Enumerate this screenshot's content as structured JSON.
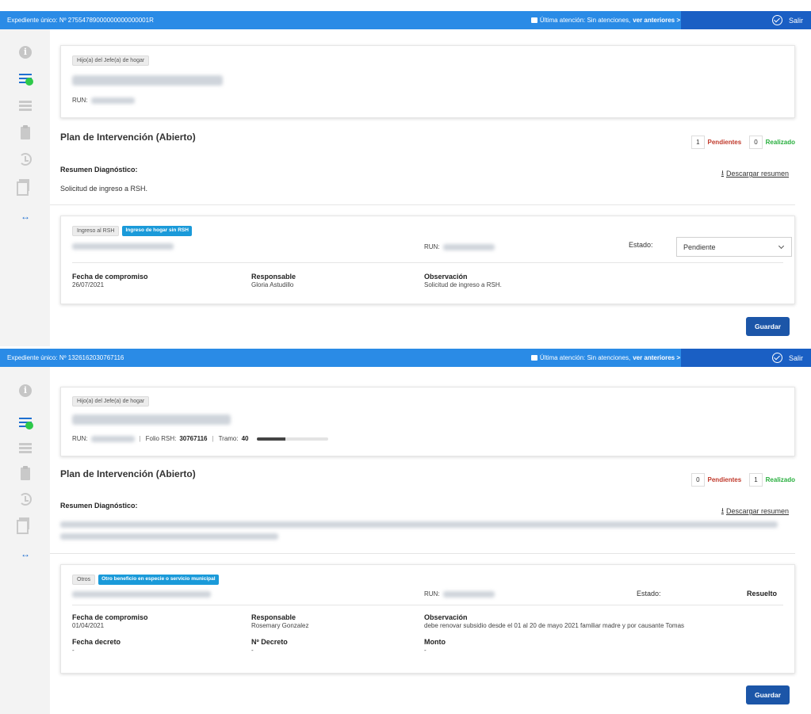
{
  "panels": [
    {
      "header": {
        "expediente": "Expediente único: Nº 27554789000000000000001R",
        "ultima_prefix": "Última atención: Sin atenciones,",
        "ultima_link": "ver anteriores >",
        "salir": "Salir"
      },
      "person": {
        "role_tag": "Hijo(a) del Jefe(a) de hogar",
        "run_label": "RUN:"
      },
      "plan": {
        "title": "Plan de Intervención (Abierto)",
        "pendientes_count": "1",
        "pendientes_label": "Pendientes",
        "realizado_count": "0",
        "realizado_label": "Realizado",
        "resumen_label": "Resumen Diagnóstico:",
        "download_label": "Descargar resumen",
        "diagnostico": "Solicitud de ingreso a RSH."
      },
      "commitment": {
        "tag": "Ingreso al RSH",
        "tag_highlight": "Ingreso de hogar sin RSH",
        "run_label": "RUN:",
        "estado_label": "Estado:",
        "estado_value": "Pendiente",
        "fecha_label": "Fecha de compromiso",
        "fecha_value": "26/07/2021",
        "responsable_label": "Responsable",
        "responsable_value": "Gloria Astudillo",
        "observacion_label": "Observación",
        "observacion_value": "Solicitud de ingreso a RSH."
      },
      "save_label": "Guardar"
    },
    {
      "header": {
        "expediente": "Expediente único: Nº 1326162030767116",
        "ultima_prefix": "Última atención: Sin atenciones,",
        "ultima_link": "ver anteriores >",
        "salir": "Salir"
      },
      "person": {
        "role_tag": "Hijo(a) del Jefe(a) de hogar",
        "run_label": "RUN:",
        "folio_label": "Folio RSH:",
        "folio_value": "30767116",
        "tramo_label": "Tramo:",
        "tramo_value": "40",
        "tramo_level": 0.4
      },
      "plan": {
        "title": "Plan de Intervención (Abierto)",
        "pendientes_count": "0",
        "pendientes_label": "Pendientes",
        "realizado_count": "1",
        "realizado_label": "Realizado",
        "resumen_label": "Resumen Diagnóstico:",
        "download_label": "Descargar resumen"
      },
      "commitment": {
        "tag": "Otros",
        "tag_highlight": "Otro beneficio en especie o servicio municipal",
        "run_label": "RUN:",
        "estado_label": "Estado:",
        "estado_value": "Resuelto",
        "fecha_label": "Fecha de compromiso",
        "fecha_value": "01/04/2021",
        "responsable_label": "Responsable",
        "responsable_value": "Rosemary Gonzalez",
        "observacion_label": "Observación",
        "observacion_value": "debe renovar subsidio desde el 01 al 20 de mayo 2021 familiar madre y por causante Tomas",
        "fecha_decreto_label": "Fecha decreto",
        "fecha_decreto_value": "-",
        "n_decreto_label": "Nº Decreto",
        "n_decreto_value": "-",
        "monto_label": "Monto",
        "monto_value": "-"
      },
      "save_label": "Guardar"
    }
  ],
  "colors": {
    "topbar": "#2a8be6",
    "salir_bg": "#1a5fc4",
    "button": "#1c56a8",
    "pendientes": "#c0392b",
    "realizado": "#27ae3d",
    "tag_highlight": "#1a9ad9",
    "status_dot": "#2ec94a"
  },
  "icons": [
    "info-icon",
    "list-icon",
    "grid-icon",
    "clipboard-icon",
    "history-icon",
    "copy-icon",
    "expand-icon",
    "calendar-icon",
    "check-circle-icon",
    "download-icon",
    "chevron-down-icon"
  ]
}
